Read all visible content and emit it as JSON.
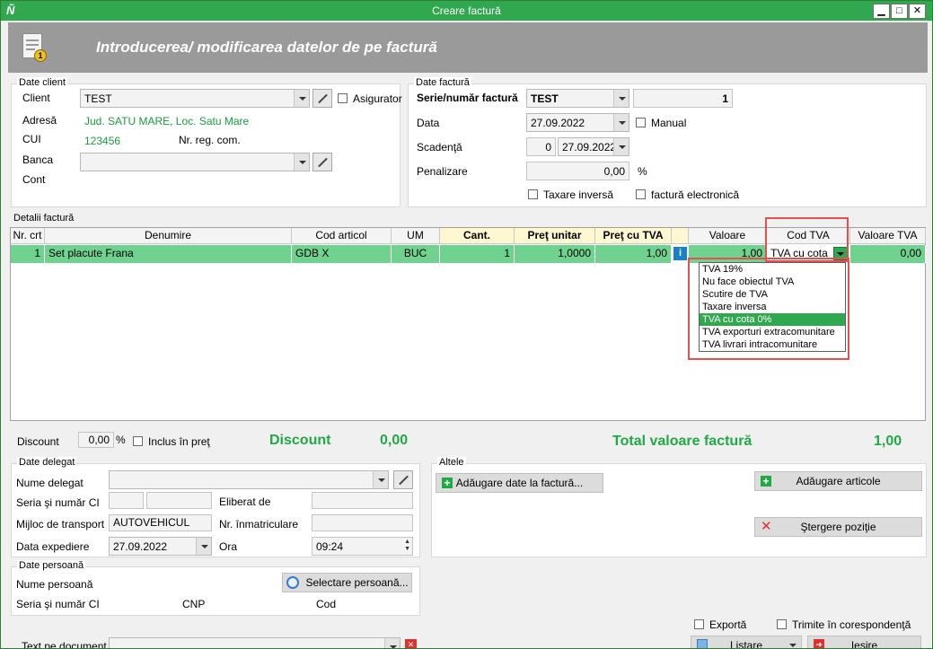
{
  "window": {
    "title": "Creare factură"
  },
  "banner": {
    "heading": "Introducerea/ modificarea datelor de pe factură"
  },
  "client": {
    "group_label": "Date client",
    "client_label": "Client",
    "client_value": "TEST",
    "asigurator_label": "Asigurator",
    "adresa_label": "Adresă",
    "adresa_value": "Jud. SATU MARE, Loc. Satu Mare",
    "cui_label": "CUI",
    "cui_value": "123456",
    "nr_reg_label": "Nr. reg. com.",
    "banca_label": "Banca",
    "banca_value": "",
    "cont_label": "Cont"
  },
  "invoice": {
    "group_label": "Date factură",
    "serie_label": "Serie/număr factură",
    "serie_value": "TEST",
    "numar_value": "1",
    "data_label": "Data",
    "data_value": "27.09.2022",
    "manual_label": "Manual",
    "scadenta_label": "Scadenţă",
    "scadenta_days": "0",
    "scadenta_value": "27.09.2022",
    "penalizare_label": "Penalizare",
    "penalizare_value": "0,00",
    "penalizare_unit": "%",
    "taxare_label": "Taxare inversă",
    "electronica_label": "factură electronică"
  },
  "details": {
    "group_label": "Detalii factură",
    "columns": [
      "Nr. crt",
      "Denumire",
      "Cod articol",
      "UM",
      "Cant.",
      "Preţ unitar",
      "Preţ cu TVA",
      "",
      "Valoare",
      "Cod TVA",
      "Valoare TVA"
    ],
    "row": {
      "nr": "1",
      "denumire": "Set placute Frana",
      "cod": "GDB X",
      "um": "BUC",
      "cant": "1",
      "pret": "1,0000",
      "pret_tva": "1,00",
      "valoare": "1,00",
      "cod_tva": "TVA cu cota",
      "valoare_tva": "0,00"
    },
    "tva_options": [
      "TVA 19%",
      "Nu face obiectul TVA",
      "Scutire de TVA",
      "Taxare inversa",
      "TVA cu cota 0%",
      "TVA exporturi extracomunitare",
      "TVA livrari intracomunitare"
    ],
    "tva_selected": "TVA cu cota 0%"
  },
  "totals": {
    "discount_label": "Discount",
    "discount_value": "0,00",
    "discount_unit": "%",
    "inclus_label": "Inclus în preţ",
    "discount_big_label": "Discount",
    "discount_big_value": "0,00",
    "total_label": "Total valoare factură",
    "total_value": "1,00"
  },
  "delegat": {
    "group_label": "Date delegat",
    "nume_label": "Nume delegat",
    "seria_label": "Seria şi număr CI",
    "eliberat_label": "Eliberat de",
    "transport_label": "Mijloc de transport",
    "transport_value": "AUTOVEHICUL",
    "inmatriculare_label": "Nr. înmatriculare",
    "expediere_label": "Data expediere",
    "expediere_value": "27.09.2022",
    "ora_label": "Ora",
    "ora_value": "09:24"
  },
  "persoana": {
    "group_label": "Date persoană",
    "nume_label": "Nume persoană",
    "select_button": "Selectare persoană...",
    "seria_label": "Seria şi număr CI",
    "cnp_label": "CNP",
    "cod_label": "Cod"
  },
  "altele": {
    "group_label": "Altele",
    "add_date_button": "Adăugare date la factură...",
    "add_articole_button": "Adăugare articole",
    "stergere_button": "Ştergere poziţie"
  },
  "footer": {
    "text_label": "Text pe document",
    "exporta_label": "Exportă",
    "trimite_label": "Trimite în corespondenţă",
    "listare_button": "Listare",
    "iesire_button": "Ieşire"
  }
}
